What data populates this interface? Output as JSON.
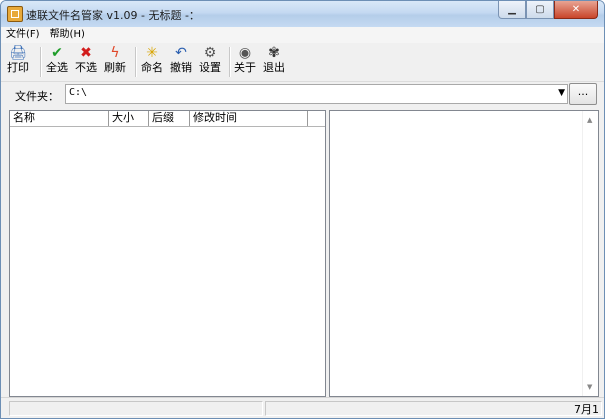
{
  "window": {
    "title": "速联文件名管家 v1.09 - 无标题 -："
  },
  "menu": [
    {
      "label": "文件(F)"
    },
    {
      "label": "帮助(H)"
    }
  ],
  "toolbar": [
    {
      "label": "打印",
      "icon": "printer-icon",
      "glyph": "🖨",
      "color": "#3b6fb6"
    },
    {
      "label": "全选",
      "icon": "check-icon",
      "glyph": "✔",
      "color": "#1f9d2a"
    },
    {
      "label": "不选",
      "icon": "cross-icon",
      "glyph": "✖",
      "color": "#d21d1d"
    },
    {
      "label": "刷新",
      "icon": "refresh-icon",
      "glyph": "ϟ",
      "color": "#e0482a"
    },
    {
      "label": "命名",
      "icon": "rename-star-icon",
      "glyph": "✳",
      "color": "#d8a400"
    },
    {
      "label": "撤销",
      "icon": "undo-icon",
      "glyph": "↶",
      "color": "#2b5fb0"
    },
    {
      "label": "设置",
      "icon": "settings-icon",
      "glyph": "⚙",
      "color": "#555555"
    },
    {
      "label": "关于",
      "icon": "about-icon",
      "glyph": "◉",
      "color": "#555555"
    },
    {
      "label": "退出",
      "icon": "exit-icon",
      "glyph": "✾",
      "color": "#333333"
    }
  ],
  "folder": {
    "label": "文件夹：",
    "value": "C:\\",
    "browse": "..."
  },
  "columns": [
    {
      "label": "名称"
    },
    {
      "label": "大小"
    },
    {
      "label": "后缀"
    },
    {
      "label": "修改时间"
    }
  ],
  "status": {
    "date": "7月1"
  }
}
